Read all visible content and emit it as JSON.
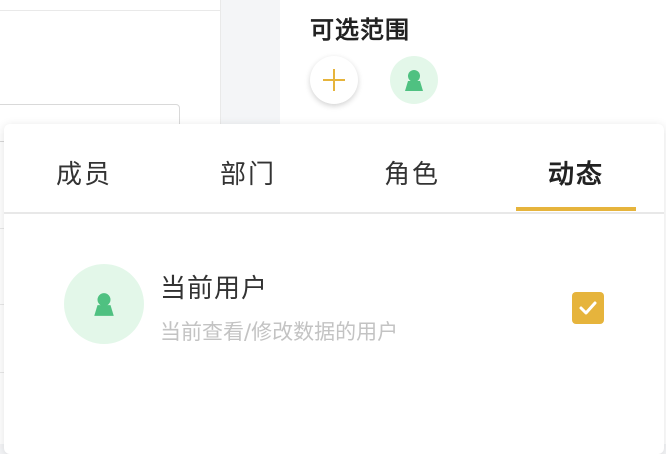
{
  "scope": {
    "title": "可选范围",
    "add_icon": "plus-icon",
    "member_icon": "user-icon"
  },
  "tabs": [
    {
      "label": "成员",
      "active": false
    },
    {
      "label": "部门",
      "active": false
    },
    {
      "label": "角色",
      "active": false
    },
    {
      "label": "动态",
      "active": true
    }
  ],
  "option": {
    "title": "当前用户",
    "description": "当前查看/修改数据的用户",
    "checked": true,
    "icon": "user-icon"
  },
  "colors": {
    "accent": "#e6b43c",
    "avatar_bg": "#e3f7e9",
    "avatar_fg": "#4fc181"
  }
}
